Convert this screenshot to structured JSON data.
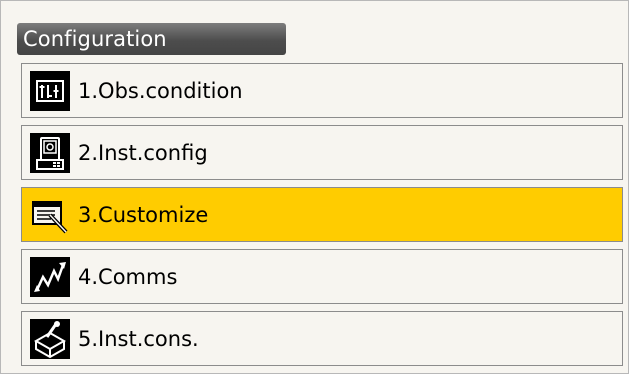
{
  "header": {
    "title": "Configuration"
  },
  "menu": {
    "items": [
      {
        "label": "1.Obs.condition",
        "icon": "obs-condition-icon"
      },
      {
        "label": "2.Inst.config",
        "icon": "instrument-icon"
      },
      {
        "label": "3.Customize",
        "icon": "customize-icon",
        "selected": true
      },
      {
        "label": "4.Comms",
        "icon": "comms-icon"
      },
      {
        "label": "5.Inst.cons.",
        "icon": "inst-cons-icon"
      }
    ]
  },
  "colors": {
    "selected_bg": "#ffcc00",
    "title_bar": "#555555",
    "item_border": "#8c8c8c"
  }
}
